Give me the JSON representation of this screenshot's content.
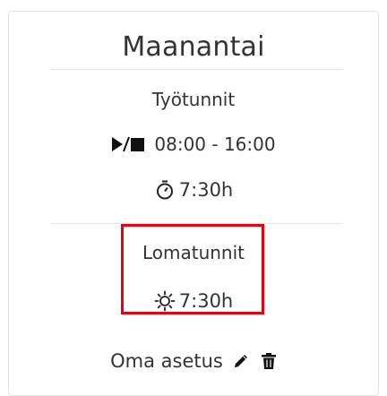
{
  "day": {
    "title": "Maanantai"
  },
  "work": {
    "label": "Työtunnit",
    "time_range": "08:00 - 16:00",
    "hours": "7:30h"
  },
  "leave": {
    "label": "Lomatunnit",
    "hours": "7:30h"
  },
  "custom": {
    "label": "Oma asetus"
  },
  "icons": {
    "time_range": "play-stop-icon",
    "duration": "stopwatch-icon",
    "leave": "sun-icon",
    "edit": "pencil-icon",
    "delete": "trash-icon"
  },
  "colors": {
    "highlight": "#e8000b",
    "text": "#333333"
  }
}
